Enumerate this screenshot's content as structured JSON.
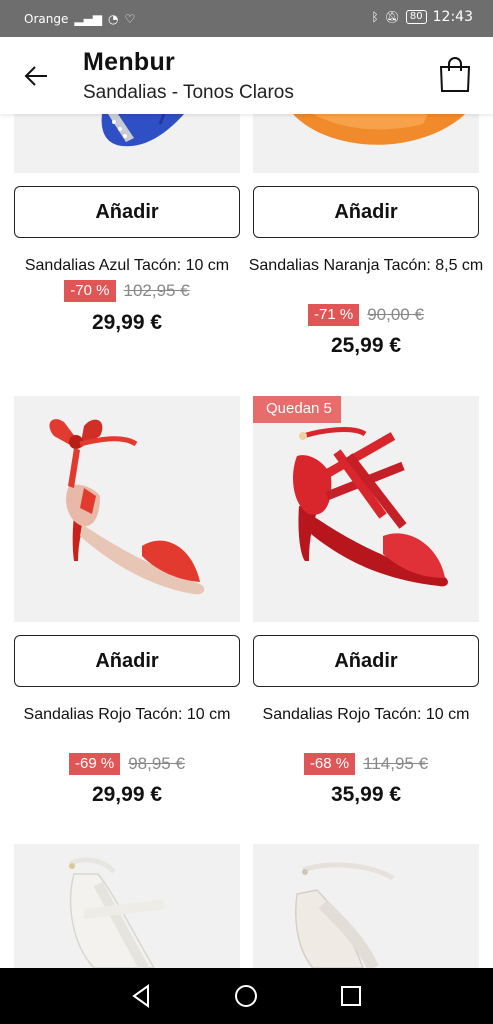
{
  "status_bar": {
    "carrier": "Orange",
    "battery": "80",
    "time": "12:43"
  },
  "header": {
    "title": "Menbur",
    "subtitle": "Sandalias - Tonos Claros"
  },
  "add_label": "Añadir",
  "products": [
    {
      "name": "Sandalias Azul Tacón: 10 cm",
      "discount": "-70 %",
      "old_price": "102,95 €",
      "price": "29,99 €",
      "color": "#2f4fc4"
    },
    {
      "name": "Sandalias Naranja Tacón: 8,5 cm",
      "discount": "-71 %",
      "old_price": "90,00 €",
      "price": "25,99 €",
      "color": "#f08a2a"
    },
    {
      "name": "Sandalias Rojo Tacón: 10 cm",
      "discount": "-69 %",
      "old_price": "98,95 €",
      "price": "29,99 €",
      "color": "#e23a2e"
    },
    {
      "name": "Sandalias Rojo Tacón: 10 cm",
      "badge": "Quedan 5",
      "discount": "-68 %",
      "old_price": "114,95 €",
      "price": "35,99 €",
      "color": "#d9262d"
    }
  ],
  "colors": {
    "badge": "#e86c6c",
    "discount": "#e05656",
    "status_bar": "#6e6e6e",
    "image_bg": "#f1f1f1"
  }
}
